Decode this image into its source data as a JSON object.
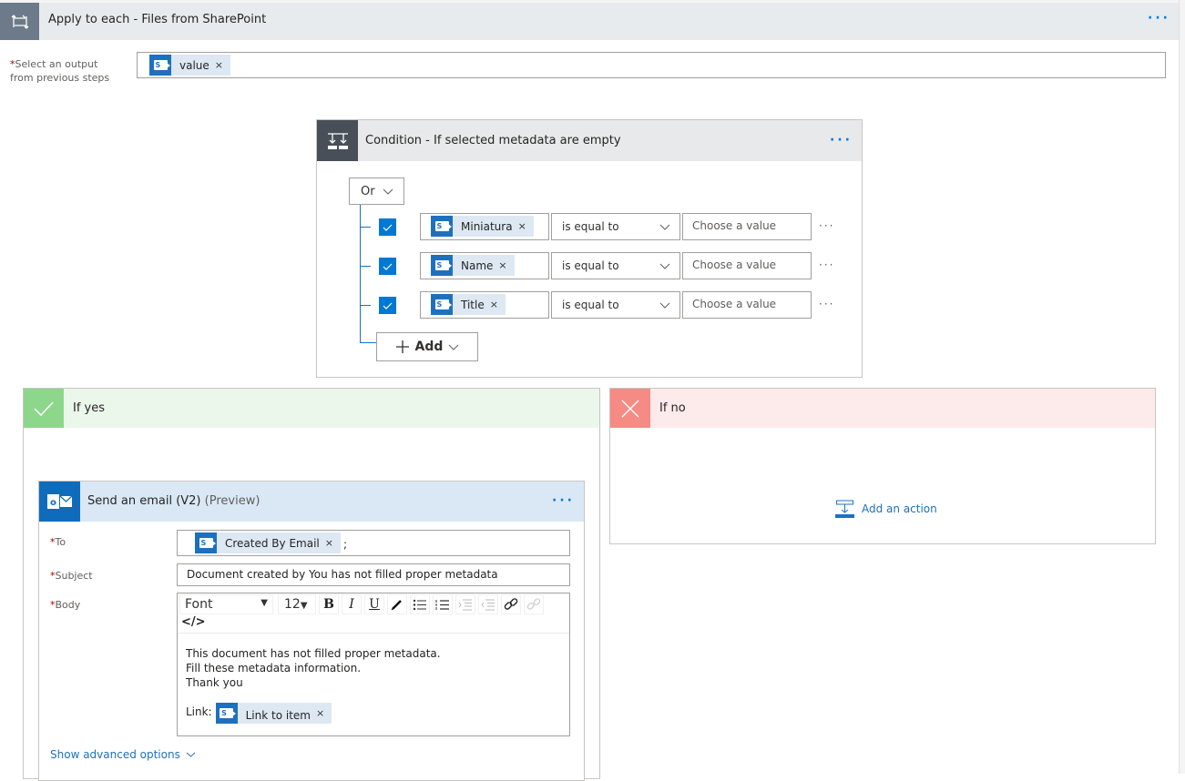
{
  "apply_to_each": {
    "title": "Apply to each - Files from SharePoint",
    "icon": "loop-icon",
    "more": "···",
    "output_label_req": "*",
    "output_label": "Select an output from previous steps",
    "output_token": {
      "label": "value",
      "remove": "×",
      "icon": "sharepoint-icon"
    }
  },
  "condition": {
    "title": "Condition - If selected metadata are empty",
    "icon": "condition-icon",
    "more": "···",
    "group_operator": "Or",
    "rows": [
      {
        "checked": true,
        "field": "Miniatura",
        "operator": "is equal to",
        "value_placeholder": "Choose a value"
      },
      {
        "checked": true,
        "field": "Name",
        "operator": "is equal to",
        "value_placeholder": "Choose a value"
      },
      {
        "checked": true,
        "field": "Title",
        "operator": "is equal to",
        "value_placeholder": "Choose a value"
      }
    ],
    "row_more": "···",
    "remove": "×",
    "add_label": "Add"
  },
  "if_yes": {
    "title": "If yes",
    "color": "#8cd78c"
  },
  "if_no": {
    "title": "If no",
    "color": "#f68b85",
    "add_action": "Add an action"
  },
  "email": {
    "title": "Send an email (V2)",
    "preview": "(Preview)",
    "more": "···",
    "to_label": "To",
    "to_token": "Created By Email",
    "to_suffix": ";",
    "subject_label": "Subject",
    "subject_value": "Document created by You has not filled proper metadata",
    "body_label": "Body",
    "toolbar": {
      "font": "Font",
      "size": "12",
      "bold": "B",
      "italic": "I",
      "underline": "U",
      "code": "</>"
    },
    "body_lines": [
      "This document has not filled proper metadata.",
      "Fill these metadata information.",
      "Thank you"
    ],
    "link_label": "Link:",
    "link_token": "Link to item",
    "required_mark": "*",
    "remove": "×",
    "show_advanced": "Show advanced options"
  }
}
